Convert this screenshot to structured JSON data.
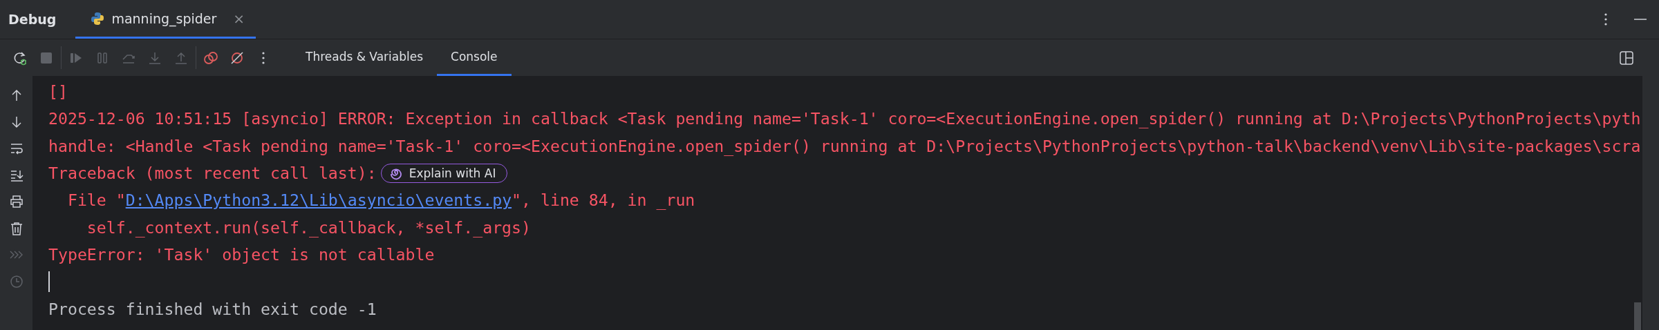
{
  "title_bar": {
    "title": "Debug",
    "tabs": [
      {
        "label": "manning_spider",
        "selected": true,
        "close": "×"
      }
    ]
  },
  "toolbar": {
    "groups": [
      [
        {
          "kind": "rerun",
          "disabled": false
        },
        {
          "kind": "stop",
          "disabled": true
        }
      ],
      [
        {
          "kind": "resume",
          "disabled": true
        },
        {
          "kind": "pause",
          "disabled": true
        },
        {
          "kind": "step-over",
          "disabled": true
        },
        {
          "kind": "step-into",
          "disabled": true
        },
        {
          "kind": "step-out",
          "disabled": true
        }
      ],
      [
        {
          "kind": "breakpoints",
          "disabled": false
        },
        {
          "kind": "mute-breakpoints",
          "disabled": false
        },
        {
          "kind": "more",
          "disabled": false
        }
      ]
    ],
    "tabs": [
      {
        "label": "Threads & Variables",
        "selected": false
      },
      {
        "label": "Console",
        "selected": true
      }
    ]
  },
  "gutter": [
    {
      "kind": "up",
      "disabled": false
    },
    {
      "kind": "down",
      "disabled": false
    },
    {
      "kind": "wrap",
      "disabled": false
    },
    {
      "kind": "scroll-end",
      "disabled": false
    },
    {
      "kind": "print",
      "disabled": false
    },
    {
      "kind": "trash",
      "disabled": false
    },
    {
      "kind": "prompt",
      "disabled": true
    },
    {
      "kind": "history",
      "disabled": true
    }
  ],
  "console": [
    {
      "kind": "error",
      "text": "[]"
    },
    {
      "kind": "error",
      "text": "2025-12-06 10:51:15 [asyncio] ERROR: Exception in callback <Task pending name='Task-1' coro=<ExecutionEngine.open_spider() running at D:\\Projects\\PythonProjects\\pyth"
    },
    {
      "kind": "error",
      "text": "handle: <Handle <Task pending name='Task-1' coro=<ExecutionEngine.open_spider() running at D:\\Projects\\PythonProjects\\python-talk\\backend\\venv\\Lib\\site-packages\\scra"
    },
    {
      "kind": "traceback",
      "text": "Traceback (most recent call last):",
      "button": "Explain with AI"
    },
    {
      "kind": "link",
      "before": "  File \"",
      "link": "D:\\Apps\\Python3.12\\Lib\\asyncio\\events.py",
      "after": "\", line 84, in _run"
    },
    {
      "kind": "error",
      "text": "    self._context.run(self._callback, *self._args)"
    },
    {
      "kind": "error",
      "text": "TypeError: 'Task' object is not callable"
    },
    {
      "kind": "caret"
    },
    {
      "kind": "output",
      "text": "Process finished with exit code -1"
    }
  ]
}
